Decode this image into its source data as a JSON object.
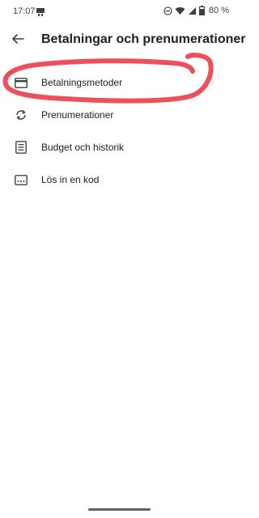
{
  "status_bar": {
    "time": "17:07",
    "battery": "80 %",
    "icons": [
      "notification-icon",
      "dnd-icon",
      "wifi-icon",
      "signal-icon",
      "battery-icon"
    ]
  },
  "header": {
    "title": "Betalningar och prenumerationer",
    "back_icon": "arrow-left-icon"
  },
  "menu": {
    "items": [
      {
        "label": "Betalningsmetoder",
        "icon": "credit-card-icon"
      },
      {
        "label": "Prenumerationer",
        "icon": "sync-icon"
      },
      {
        "label": "Budget och historik",
        "icon": "list-document-icon"
      },
      {
        "label": "Lös in en kod",
        "icon": "redeem-code-icon"
      }
    ]
  },
  "colors": {
    "annotation": "#ef4f5b",
    "text": "#202124",
    "icon": "#3c4043"
  }
}
